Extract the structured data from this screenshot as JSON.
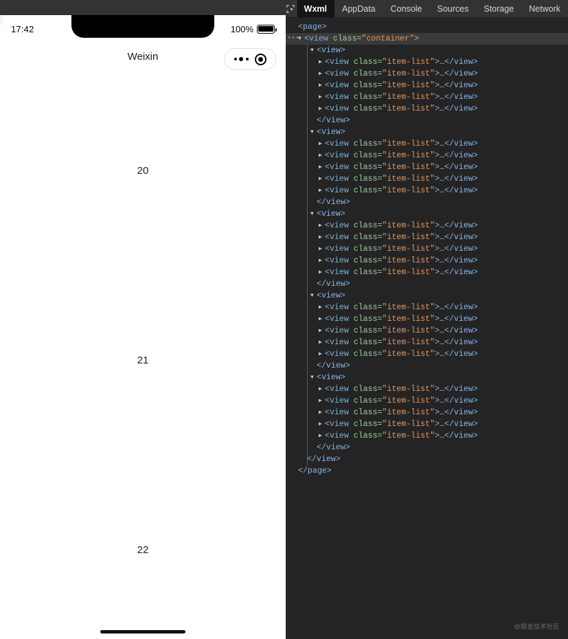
{
  "simulator": {
    "status_bar": {
      "time": "17:42",
      "battery_percent": "100%",
      "battery_icon": "battery-full-icon"
    },
    "nav": {
      "title": "Weixin",
      "capsule": {
        "more_icon": "more-dots-icon",
        "close_icon": "target-circle-icon"
      }
    },
    "list_items": [
      {
        "label": "20"
      },
      {
        "label": "21"
      },
      {
        "label": "22"
      }
    ],
    "home_indicator": "home-indicator"
  },
  "devtools": {
    "inspect_icon": "inspect-element-icon",
    "tabs": [
      {
        "label": "Wxml",
        "active": true
      },
      {
        "label": "AppData",
        "active": false
      },
      {
        "label": "Console",
        "active": false
      },
      {
        "label": "Sources",
        "active": false
      },
      {
        "label": "Storage",
        "active": false
      },
      {
        "label": "Network",
        "active": false
      }
    ],
    "tree": {
      "open_page": "<page>",
      "close_page": "</page>",
      "container_lt": "<",
      "container_el": "view",
      "container_attr": " class=",
      "container_val": "\"container\"",
      "container_gt": ">",
      "view_open": "<view>",
      "view_close": "</view>",
      "item_lt": "<",
      "item_el": "view",
      "item_attr": " class=",
      "item_val": "\"item-list\"",
      "item_gt": ">",
      "item_ellipsis": "…",
      "item_close": "</view>",
      "group_count": 5,
      "items_per_group": 5
    },
    "watermark": "@掘金技术社区"
  }
}
